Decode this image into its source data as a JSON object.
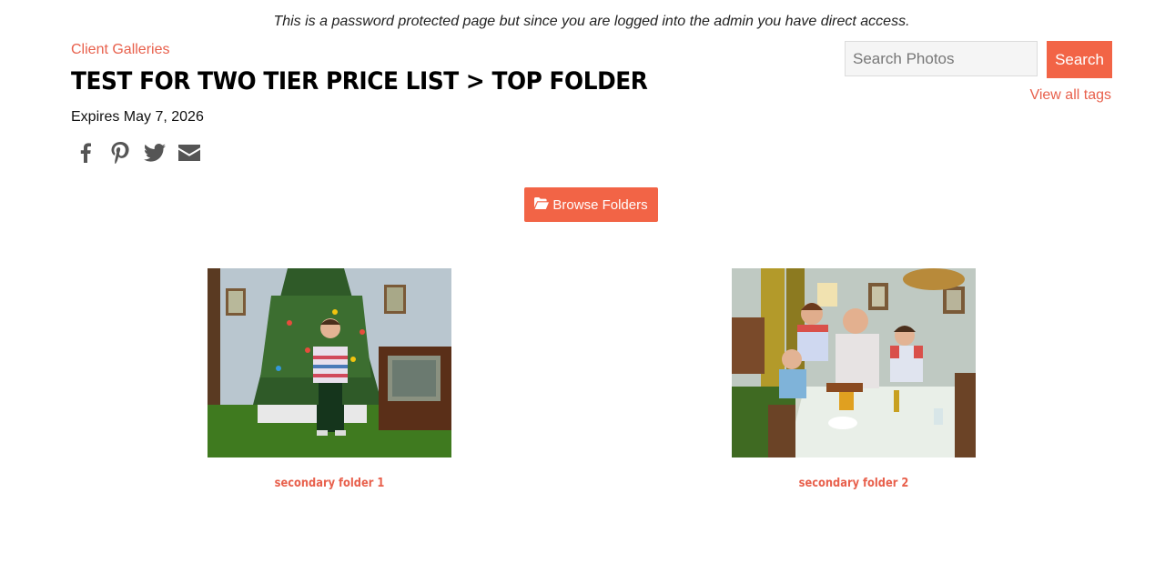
{
  "notice": "This is a password protected page but since you are logged into the admin you have direct access.",
  "breadcrumb": {
    "label": "Client Galleries"
  },
  "gallery": {
    "title": "TEST FOR TWO TIER PRICE LIST > TOP FOLDER",
    "expires": "Expires May 7, 2026"
  },
  "share_icons": [
    "facebook-icon",
    "pinterest-icon",
    "twitter-icon",
    "email-icon"
  ],
  "search": {
    "placeholder": "Search Photos",
    "value": "",
    "button_label": "Search",
    "tags_link": "View all tags"
  },
  "browse": {
    "label": "Browse Folders",
    "icon": "folder-open-icon"
  },
  "folders": [
    {
      "label": "secondary folder 1"
    },
    {
      "label": "secondary folder 2"
    }
  ],
  "colors": {
    "accent": "#f26446",
    "link": "#e8604c"
  }
}
